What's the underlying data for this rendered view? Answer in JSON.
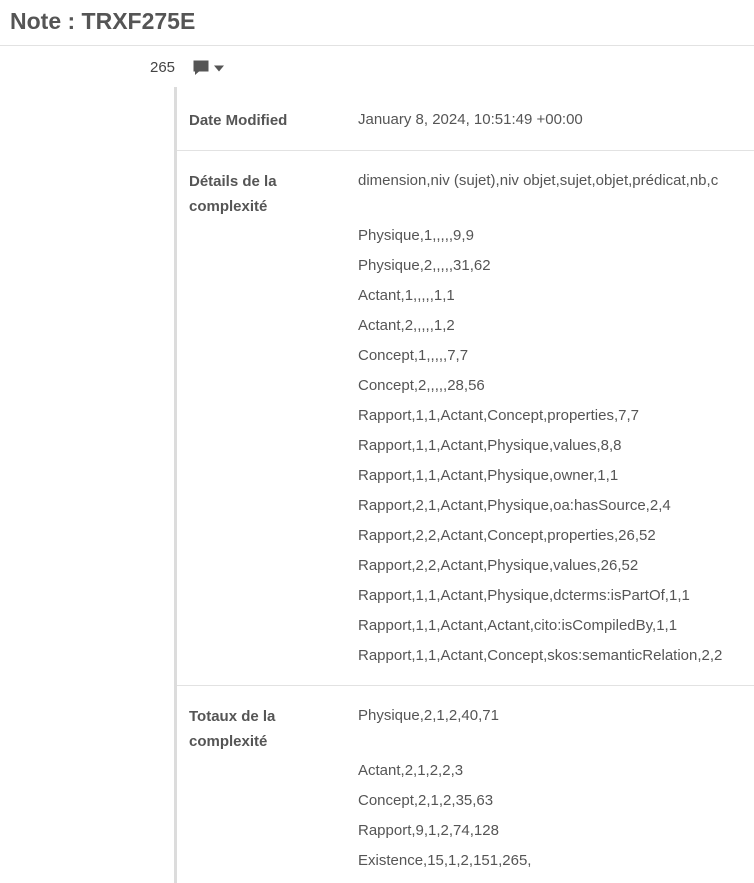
{
  "header": {
    "title": "Note : TRXF275E"
  },
  "comments": {
    "count": "265",
    "icon": "comment-icon"
  },
  "metadata": {
    "date_modified": {
      "label": "Date Modified",
      "value": "January 8, 2024, 10:51:49 +00:00"
    },
    "details": {
      "label": "Détails de la complexité",
      "lines": [
        "dimension,niv (sujet),niv objet,sujet,objet,prédicat,nb,c",
        "Physique,1,,,,,9,9",
        "Physique,2,,,,,31,62",
        "Actant,1,,,,,1,1",
        "Actant,2,,,,,1,2",
        "Concept,1,,,,,7,7",
        "Concept,2,,,,,28,56",
        "Rapport,1,1,Actant,Concept,properties,7,7",
        "Rapport,1,1,Actant,Physique,values,8,8",
        "Rapport,1,1,Actant,Physique,owner,1,1",
        "Rapport,2,1,Actant,Physique,oa:hasSource,2,4",
        "Rapport,2,2,Actant,Concept,properties,26,52",
        "Rapport,2,2,Actant,Physique,values,26,52",
        "Rapport,1,1,Actant,Physique,dcterms:isPartOf,1,1",
        "Rapport,1,1,Actant,Actant,cito:isCompiledBy,1,1",
        "Rapport,1,1,Actant,Concept,skos:semanticRelation,2,2"
      ]
    },
    "totals": {
      "label": "Totaux de la complexité",
      "lines": [
        "Physique,2,1,2,40,71",
        "Actant,2,1,2,2,3",
        "Concept,2,1,2,35,63",
        "Rapport,9,1,2,74,128",
        "Existence,15,1,2,151,265,"
      ]
    }
  }
}
